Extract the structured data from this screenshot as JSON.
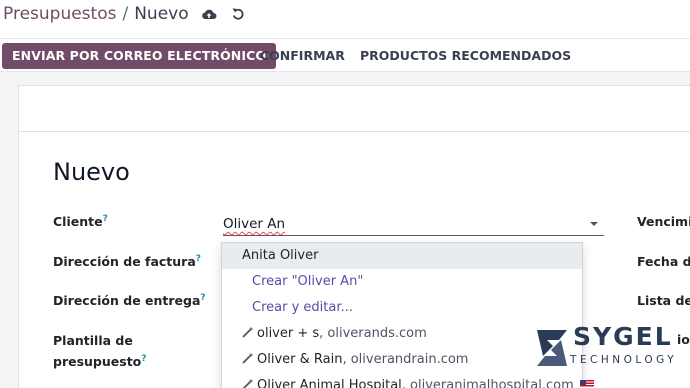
{
  "breadcrumb": {
    "parent": "Presupuestos",
    "separator": "/",
    "current": "Nuevo",
    "icons": [
      "cloud-upload-icon",
      "undo-icon"
    ]
  },
  "actions": {
    "send_email": "ENVIAR POR CORREO ELECTRÓNICO",
    "confirm": "CONFIRMAR",
    "recommended": "PRODUCTOS RECOMENDADOS"
  },
  "form": {
    "title": "Nuevo",
    "fields": {
      "client": "Cliente",
      "invoice_address": "Dirección de factura",
      "delivery_address": "Dirección de entrega",
      "template_line1": "Plantilla de",
      "template_line2": "presupuesto"
    },
    "help_marker": "?",
    "client_value": "Oliver An",
    "right_labels": {
      "expiration": "Vencimie",
      "date": "Fecha de",
      "pricelist": "Lista de p",
      "other": "io"
    }
  },
  "dropdown": {
    "items": [
      {
        "type": "result",
        "text": "Anita Oliver"
      },
      {
        "type": "action",
        "text": "Crear \"Oliver An\""
      },
      {
        "type": "action",
        "text": "Crear y editar..."
      },
      {
        "type": "partner",
        "name": "oliver + s",
        "domain": ", oliverands.com"
      },
      {
        "type": "partner",
        "name": "Oliver & Rain",
        "domain": ", oliverandrain.com"
      },
      {
        "type": "partner",
        "name": "Oliver Animal Hospital",
        "domain": ", oliveranimalhospital.com"
      }
    ]
  },
  "logo": {
    "wordmark": "SYGEL",
    "tagline": "TECHNOLOGY"
  },
  "colors": {
    "primary": "#714b67",
    "link": "#5a4aa6",
    "help": "#1a8fb0",
    "logo": "#2b3a55"
  }
}
